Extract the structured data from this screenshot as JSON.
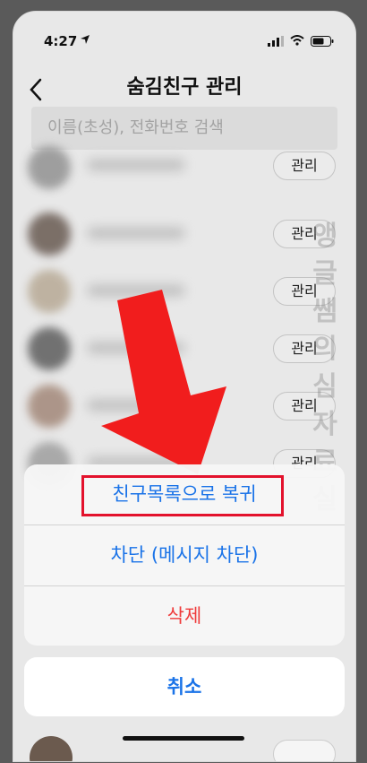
{
  "status_bar": {
    "time": "4:27"
  },
  "nav": {
    "title": "숨김친구 관리"
  },
  "search": {
    "placeholder": "이름(초성), 전화번호 검색"
  },
  "list": {
    "manage_label": "관리"
  },
  "action_sheet": {
    "restore_label": "친구목록으로 복귀",
    "block_label": "차단 (메시지 차단)",
    "delete_label": "삭제",
    "cancel_label": "취소"
  },
  "watermark": {
    "text": "앵글쌤의심자료실"
  },
  "colors": {
    "accent": "#1a73e8",
    "danger": "#ef3b3b",
    "highlight": "#e3122c",
    "arrow": "#f11d1d"
  }
}
